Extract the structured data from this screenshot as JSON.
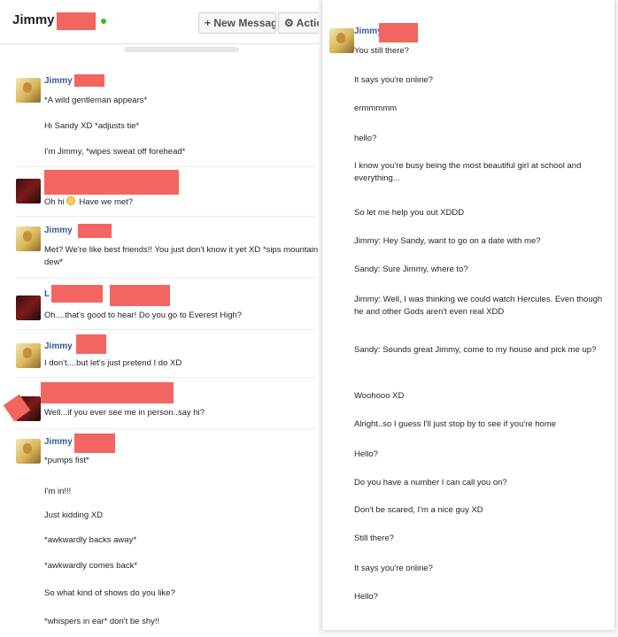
{
  "left": {
    "header": {
      "name": "Jimmy",
      "new_message_label": "+ New Message",
      "actions_label": "⚙ Actio"
    },
    "blocks": [
      {
        "sender": "Jimmy",
        "avatar": "jimmy",
        "messages": [
          "*A wild gentleman appears*",
          "Hi Sandy XD *adjusts tie*",
          "I'm Jimmy, *wipes sweat off forehead*"
        ]
      },
      {
        "sender": "",
        "avatar": "sandy",
        "messages": [
          "Oh hi",
          "Have we met?"
        ]
      },
      {
        "sender": "Jimmy",
        "avatar": "jimmy",
        "messages": [
          "Met? We're like best friends!! You just don't know it yet XD *sips mountain dew*"
        ]
      },
      {
        "sender": "L",
        "avatar": "sandy",
        "messages": [
          "Oh....that's good to hear! Do you go to Everest High?"
        ]
      },
      {
        "sender": "Jimmy",
        "avatar": "jimmy",
        "messages": [
          "I don't....but let's just pretend I do XD"
        ]
      },
      {
        "sender": "",
        "avatar": "sandy",
        "messages": [
          "Well...if you ever see me in person..say hi?"
        ]
      },
      {
        "sender": "Jimmy",
        "avatar": "jimmy",
        "messages": [
          "*pumps fist*",
          "I'm in!!!",
          "Just kidding XD",
          "*awkwardly backs away*",
          "*awkwardly comes back*",
          "So what kind of shows do you like?",
          "*whispers in ear* don't be shy!!"
        ]
      }
    ]
  },
  "right": {
    "sender": "Jimmy",
    "messages": [
      "You still there?",
      "It says you're online?",
      "ermmmmm",
      "hello?",
      "I know you're busy being the most beautiful girl at school and everything...",
      "So let me help you out XDDD",
      "Jimmy:  Hey Sandy, want to go on a date with me?",
      "Sandy:  Sure Jimmy, where to?",
      "Jimmy:  Well, I was thinking we could watch Hercules.  Even though he and other Gods aren't even real XDD",
      "Sandy:  Sounds great Jimmy, come to my house and pick me up?",
      "Woohooo XD",
      "Alright..so I guess I'll just stop by to see if you're home",
      "Hello?",
      "Do you have a number I can call you on?",
      "Don't be scared, I'm a nice guy XD",
      "Still there?",
      "It says you're online?",
      "Hello?"
    ]
  },
  "colors": {
    "link_name": "#365899",
    "redaction": "#f26560",
    "online": "#42b72a"
  }
}
